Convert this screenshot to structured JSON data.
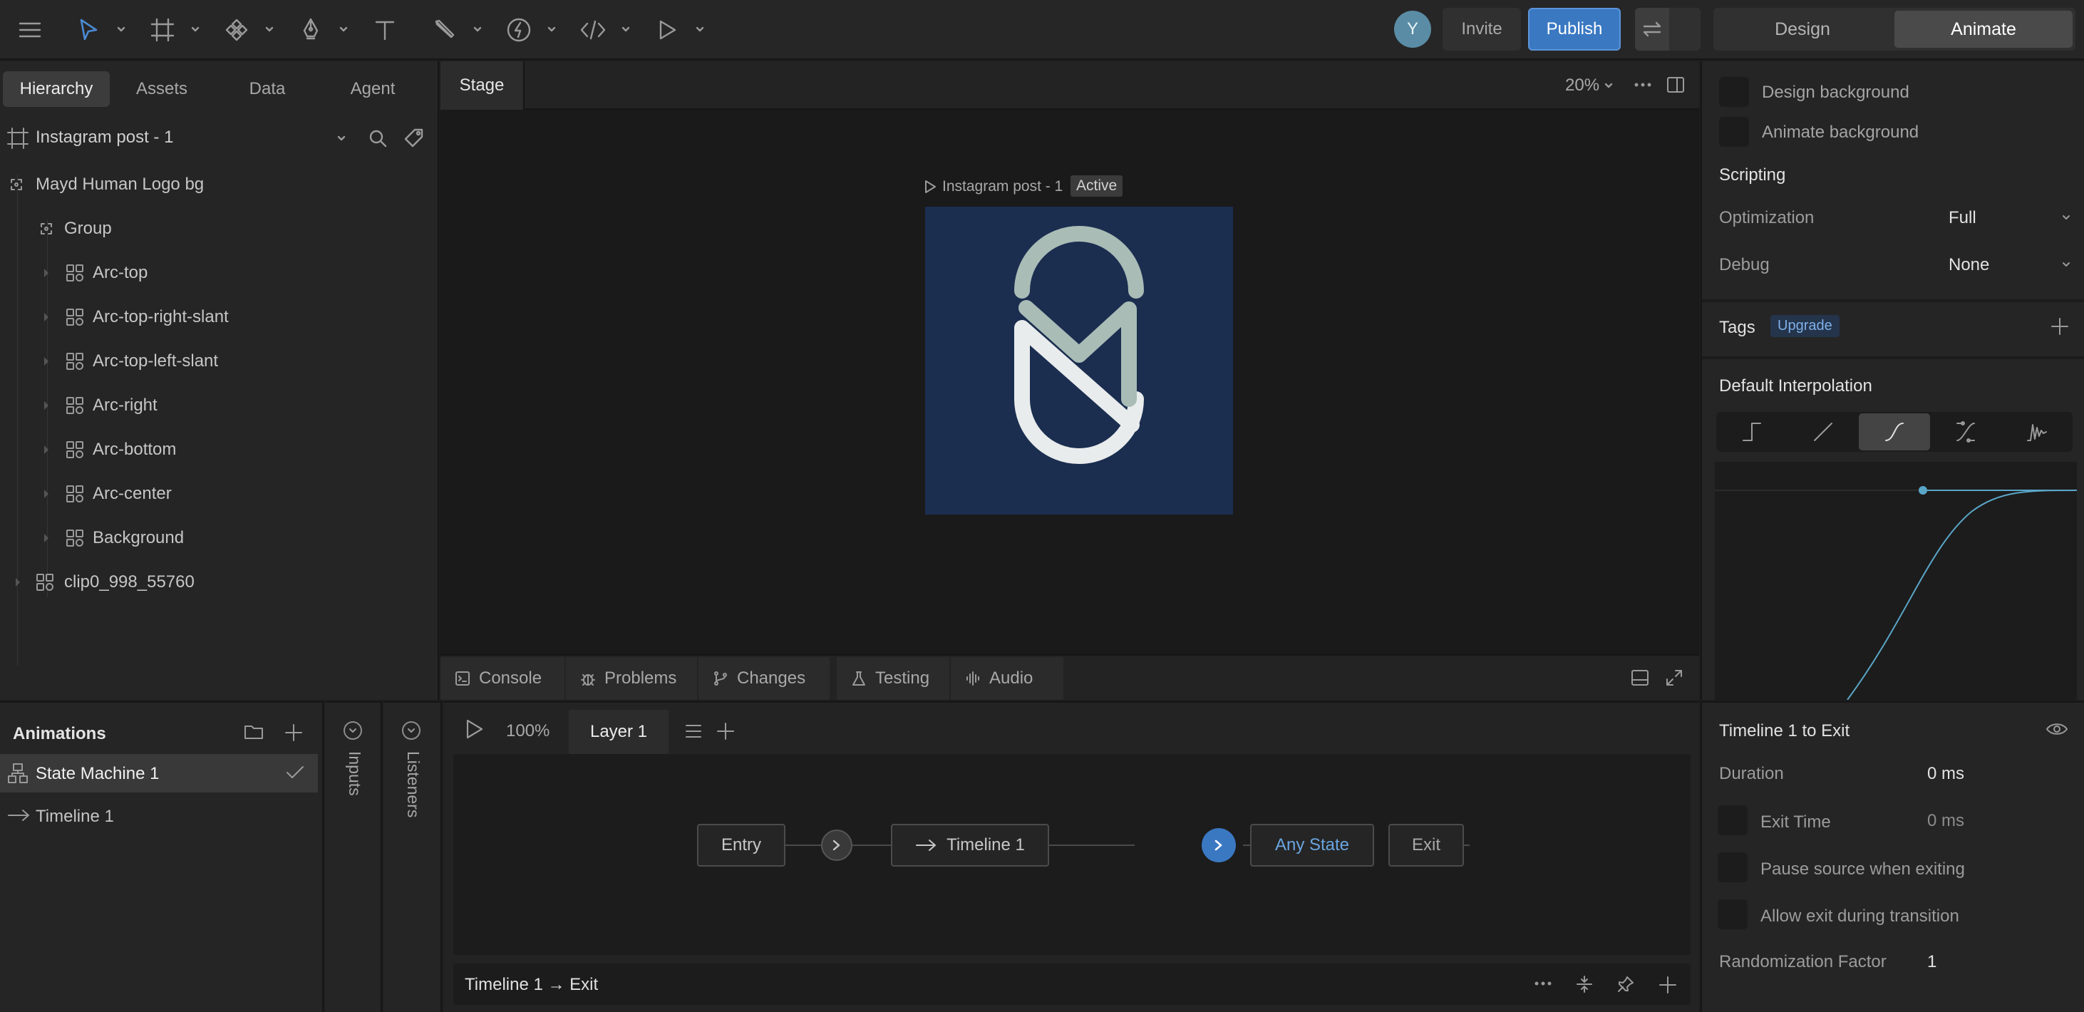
{
  "toolbar": {
    "avatar_initial": "Y",
    "invite_label": "Invite",
    "publish_label": "Publish",
    "mode_design": "Design",
    "mode_animate": "Animate",
    "accent_color": "#4a8bd4",
    "publish_color": "#3a78c2"
  },
  "left_panel": {
    "tabs": [
      "Hierarchy",
      "Assets",
      "Data",
      "Agent"
    ],
    "artboard_name": "Instagram post - 1",
    "tree": [
      {
        "label": "Mayd Human Logo bg",
        "icon": "node-icon"
      },
      {
        "label": "Group",
        "icon": "group-icon"
      },
      {
        "label": "Arc-top",
        "icon": "component-icon"
      },
      {
        "label": "Arc-top-right-slant",
        "icon": "component-icon"
      },
      {
        "label": "Arc-top-left-slant",
        "icon": "component-icon"
      },
      {
        "label": "Arc-right",
        "icon": "component-icon"
      },
      {
        "label": "Arc-bottom",
        "icon": "component-icon"
      },
      {
        "label": "Arc-center",
        "icon": "component-icon"
      },
      {
        "label": "Background",
        "icon": "component-icon"
      },
      {
        "label": "clip0_998_55760",
        "icon": "component-icon"
      }
    ]
  },
  "stage": {
    "tab_label": "Stage",
    "zoom": "20%",
    "artboard_label": "Instagram post - 1",
    "active_badge": "Active",
    "artboard_bg": "#1b2e50",
    "bottom_tabs": [
      "Console",
      "Problems",
      "Changes",
      "Testing",
      "Audio"
    ]
  },
  "animations": {
    "title": "Animations",
    "items": [
      "State Machine 1",
      "Timeline 1"
    ],
    "inputs_label": "Inputs",
    "listeners_label": "Listeners"
  },
  "state_machine": {
    "speed": "100%",
    "layer_tab": "Layer 1",
    "nodes": {
      "entry": "Entry",
      "timeline": "Timeline 1",
      "any_state": "Any State",
      "exit": "Exit"
    },
    "footer_title": "Timeline 1 → Exit"
  },
  "right_panel": {
    "design_background": "Design background",
    "animate_background": "Animate background",
    "scripting": "Scripting",
    "optimization_label": "Optimization",
    "optimization_value": "Full",
    "debug_label": "Debug",
    "debug_value": "None",
    "tags_label": "Tags",
    "upgrade_badge": "Upgrade",
    "default_interpolation": "Default Interpolation",
    "transition": {
      "title": "Timeline 1 to Exit",
      "duration_label": "Duration",
      "duration_value": "0 ms",
      "exit_time_label": "Exit Time",
      "exit_time_value": "0 ms",
      "pause_label": "Pause source when exiting",
      "allow_exit_label": "Allow exit during transition",
      "randomization_label": "Randomization Factor",
      "randomization_value": "1"
    }
  }
}
